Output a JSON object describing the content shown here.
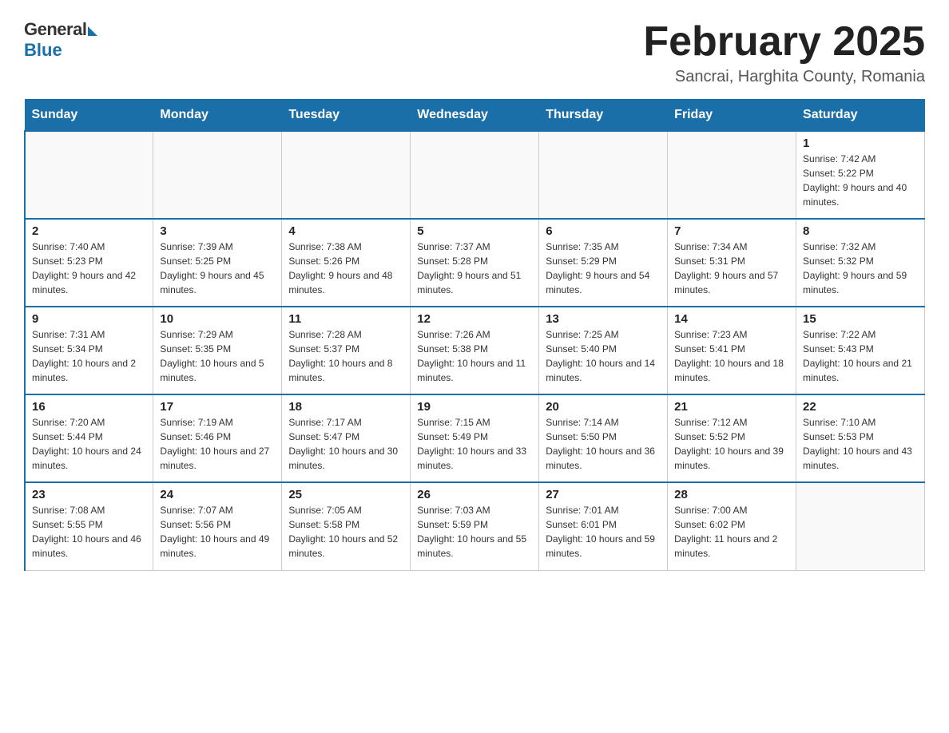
{
  "logo": {
    "general": "General",
    "blue": "Blue"
  },
  "title": "February 2025",
  "subtitle": "Sancrai, Harghita County, Romania",
  "weekdays": [
    "Sunday",
    "Monday",
    "Tuesday",
    "Wednesday",
    "Thursday",
    "Friday",
    "Saturday"
  ],
  "weeks": [
    [
      {
        "day": "",
        "info": ""
      },
      {
        "day": "",
        "info": ""
      },
      {
        "day": "",
        "info": ""
      },
      {
        "day": "",
        "info": ""
      },
      {
        "day": "",
        "info": ""
      },
      {
        "day": "",
        "info": ""
      },
      {
        "day": "1",
        "info": "Sunrise: 7:42 AM\nSunset: 5:22 PM\nDaylight: 9 hours and 40 minutes."
      }
    ],
    [
      {
        "day": "2",
        "info": "Sunrise: 7:40 AM\nSunset: 5:23 PM\nDaylight: 9 hours and 42 minutes."
      },
      {
        "day": "3",
        "info": "Sunrise: 7:39 AM\nSunset: 5:25 PM\nDaylight: 9 hours and 45 minutes."
      },
      {
        "day": "4",
        "info": "Sunrise: 7:38 AM\nSunset: 5:26 PM\nDaylight: 9 hours and 48 minutes."
      },
      {
        "day": "5",
        "info": "Sunrise: 7:37 AM\nSunset: 5:28 PM\nDaylight: 9 hours and 51 minutes."
      },
      {
        "day": "6",
        "info": "Sunrise: 7:35 AM\nSunset: 5:29 PM\nDaylight: 9 hours and 54 minutes."
      },
      {
        "day": "7",
        "info": "Sunrise: 7:34 AM\nSunset: 5:31 PM\nDaylight: 9 hours and 57 minutes."
      },
      {
        "day": "8",
        "info": "Sunrise: 7:32 AM\nSunset: 5:32 PM\nDaylight: 9 hours and 59 minutes."
      }
    ],
    [
      {
        "day": "9",
        "info": "Sunrise: 7:31 AM\nSunset: 5:34 PM\nDaylight: 10 hours and 2 minutes."
      },
      {
        "day": "10",
        "info": "Sunrise: 7:29 AM\nSunset: 5:35 PM\nDaylight: 10 hours and 5 minutes."
      },
      {
        "day": "11",
        "info": "Sunrise: 7:28 AM\nSunset: 5:37 PM\nDaylight: 10 hours and 8 minutes."
      },
      {
        "day": "12",
        "info": "Sunrise: 7:26 AM\nSunset: 5:38 PM\nDaylight: 10 hours and 11 minutes."
      },
      {
        "day": "13",
        "info": "Sunrise: 7:25 AM\nSunset: 5:40 PM\nDaylight: 10 hours and 14 minutes."
      },
      {
        "day": "14",
        "info": "Sunrise: 7:23 AM\nSunset: 5:41 PM\nDaylight: 10 hours and 18 minutes."
      },
      {
        "day": "15",
        "info": "Sunrise: 7:22 AM\nSunset: 5:43 PM\nDaylight: 10 hours and 21 minutes."
      }
    ],
    [
      {
        "day": "16",
        "info": "Sunrise: 7:20 AM\nSunset: 5:44 PM\nDaylight: 10 hours and 24 minutes."
      },
      {
        "day": "17",
        "info": "Sunrise: 7:19 AM\nSunset: 5:46 PM\nDaylight: 10 hours and 27 minutes."
      },
      {
        "day": "18",
        "info": "Sunrise: 7:17 AM\nSunset: 5:47 PM\nDaylight: 10 hours and 30 minutes."
      },
      {
        "day": "19",
        "info": "Sunrise: 7:15 AM\nSunset: 5:49 PM\nDaylight: 10 hours and 33 minutes."
      },
      {
        "day": "20",
        "info": "Sunrise: 7:14 AM\nSunset: 5:50 PM\nDaylight: 10 hours and 36 minutes."
      },
      {
        "day": "21",
        "info": "Sunrise: 7:12 AM\nSunset: 5:52 PM\nDaylight: 10 hours and 39 minutes."
      },
      {
        "day": "22",
        "info": "Sunrise: 7:10 AM\nSunset: 5:53 PM\nDaylight: 10 hours and 43 minutes."
      }
    ],
    [
      {
        "day": "23",
        "info": "Sunrise: 7:08 AM\nSunset: 5:55 PM\nDaylight: 10 hours and 46 minutes."
      },
      {
        "day": "24",
        "info": "Sunrise: 7:07 AM\nSunset: 5:56 PM\nDaylight: 10 hours and 49 minutes."
      },
      {
        "day": "25",
        "info": "Sunrise: 7:05 AM\nSunset: 5:58 PM\nDaylight: 10 hours and 52 minutes."
      },
      {
        "day": "26",
        "info": "Sunrise: 7:03 AM\nSunset: 5:59 PM\nDaylight: 10 hours and 55 minutes."
      },
      {
        "day": "27",
        "info": "Sunrise: 7:01 AM\nSunset: 6:01 PM\nDaylight: 10 hours and 59 minutes."
      },
      {
        "day": "28",
        "info": "Sunrise: 7:00 AM\nSunset: 6:02 PM\nDaylight: 11 hours and 2 minutes."
      },
      {
        "day": "",
        "info": ""
      }
    ]
  ]
}
